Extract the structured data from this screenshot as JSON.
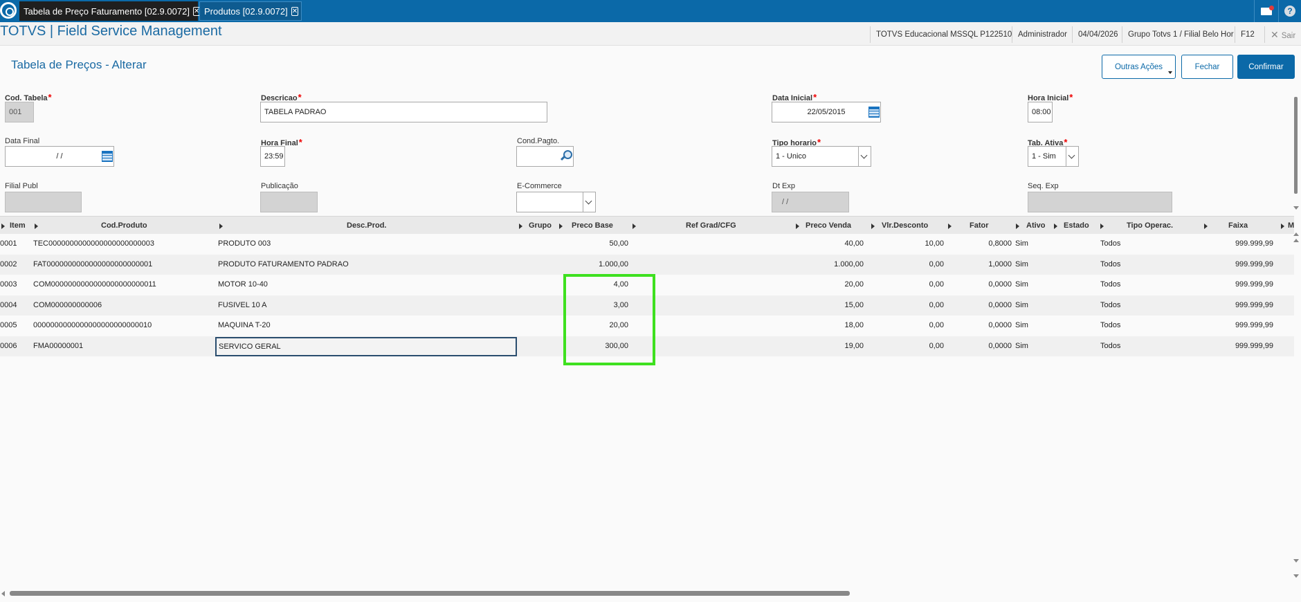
{
  "tabs": [
    {
      "label": "Tabela de Preço Faturamento [02.9.0072]",
      "close": "✕"
    },
    {
      "label": "Produtos [02.9.0072]",
      "close": "✕"
    }
  ],
  "header": {
    "app_title": "TOTVS | Field Service Management",
    "environment": "TOTVS Educacional MSSQL P122510",
    "user": "Administrador",
    "date": "04/04/2026",
    "branch": "Grupo Totvs 1 / Filial Belo Hor",
    "shortcut": "F12",
    "exit_label": "Sair",
    "exit_icon": "✕"
  },
  "page": {
    "title": "Tabela de Preços - Alterar",
    "btn_more": "Outras Ações",
    "btn_close": "Fechar",
    "btn_confirm": "Confirmar"
  },
  "form": {
    "cod_tabela": {
      "label": "Cod. Tabela",
      "value": "001"
    },
    "descricao": {
      "label": "Descricao",
      "value": "TABELA PADRAO"
    },
    "data_inicial": {
      "label": "Data Inicial",
      "value": "22/05/2015"
    },
    "hora_inicial": {
      "label": "Hora Inicial",
      "value": "08:00"
    },
    "data_final": {
      "label": "Data Final",
      "value": "/ /"
    },
    "hora_final": {
      "label": "Hora Final",
      "value": "23:59"
    },
    "cond_pagto": {
      "label": "Cond.Pagto.",
      "value": ""
    },
    "tipo_horario": {
      "label": "Tipo horario",
      "value": "1 - Unico"
    },
    "tab_ativa": {
      "label": "Tab. Ativa",
      "value": "1 - Sim"
    },
    "filial_publ": {
      "label": "Filial Publ",
      "value": ""
    },
    "publicacao": {
      "label": "Publicação",
      "value": ""
    },
    "ecommerce": {
      "label": "E-Commerce",
      "value": ""
    },
    "dt_exp": {
      "label": "Dt Exp",
      "value": "/ /"
    },
    "seq_exp": {
      "label": "Seq. Exp",
      "value": ""
    }
  },
  "grid": {
    "columns": {
      "item": "Item",
      "cod_produto": "Cod.Produto",
      "desc_prod": "Desc.Prod.",
      "grupo": "Grupo",
      "preco_base": "Preco Base",
      "ref_grad": "Ref Grad/CFG",
      "preco_venda": "Preco Venda",
      "vlr_desconto": "Vlr.Desconto",
      "fator": "Fator",
      "ativo": "Ativo",
      "estado": "Estado",
      "tipo_operac": "Tipo Operac.",
      "faixa": "Faixa",
      "more": "M"
    },
    "rows": [
      {
        "item": "0001",
        "cod": "TEC0000000000000000000000003",
        "desc": "PRODUTO 003",
        "grupo": "",
        "preco_base": "50,00",
        "ref": "",
        "preco_venda": "40,00",
        "desconto": "10,00",
        "fator": "0,8000",
        "ativo": "Sim",
        "estado": "",
        "tipo": "Todos",
        "faixa": "999.999,99"
      },
      {
        "item": "0002",
        "cod": "FAT0000000000000000000000001",
        "desc": "PRODUTO FATURAMENTO PADRAO",
        "grupo": "",
        "preco_base": "1.000,00",
        "ref": "",
        "preco_venda": "1.000,00",
        "desconto": "0,00",
        "fator": "1,0000",
        "ativo": "Sim",
        "estado": "",
        "tipo": "Todos",
        "faixa": "999.999,99"
      },
      {
        "item": "0003",
        "cod": "COM0000000000000000000000011",
        "desc": "MOTOR 10-40",
        "grupo": "",
        "preco_base": "4,00",
        "ref": "",
        "preco_venda": "20,00",
        "desconto": "0,00",
        "fator": "0,0000",
        "ativo": "Sim",
        "estado": "",
        "tipo": "Todos",
        "faixa": "999.999,99"
      },
      {
        "item": "0004",
        "cod": "COM000000000006",
        "desc": "FUSIVEL 10 A",
        "grupo": "",
        "preco_base": "3,00",
        "ref": "",
        "preco_venda": "15,00",
        "desconto": "0,00",
        "fator": "0,0000",
        "ativo": "Sim",
        "estado": "",
        "tipo": "Todos",
        "faixa": "999.999,99"
      },
      {
        "item": "0005",
        "cod": "0000000000000000000000000010",
        "desc": "MAQUINA T-20",
        "grupo": "",
        "preco_base": "20,00",
        "ref": "",
        "preco_venda": "18,00",
        "desconto": "0,00",
        "fator": "0,0000",
        "ativo": "Sim",
        "estado": "",
        "tipo": "Todos",
        "faixa": "999.999,99"
      },
      {
        "item": "0006",
        "cod": "FMA00000001",
        "desc": "SERVICO GERAL",
        "grupo": "",
        "preco_base": "300,00",
        "ref": "",
        "preco_venda": "19,00",
        "desconto": "0,00",
        "fator": "0,0000",
        "ativo": "Sim",
        "estado": "",
        "tipo": "Todos",
        "faixa": "999.999,99"
      }
    ]
  },
  "colors": {
    "brand": "#0b69a8",
    "highlight": "#3ee01f",
    "required": "#e00000"
  }
}
